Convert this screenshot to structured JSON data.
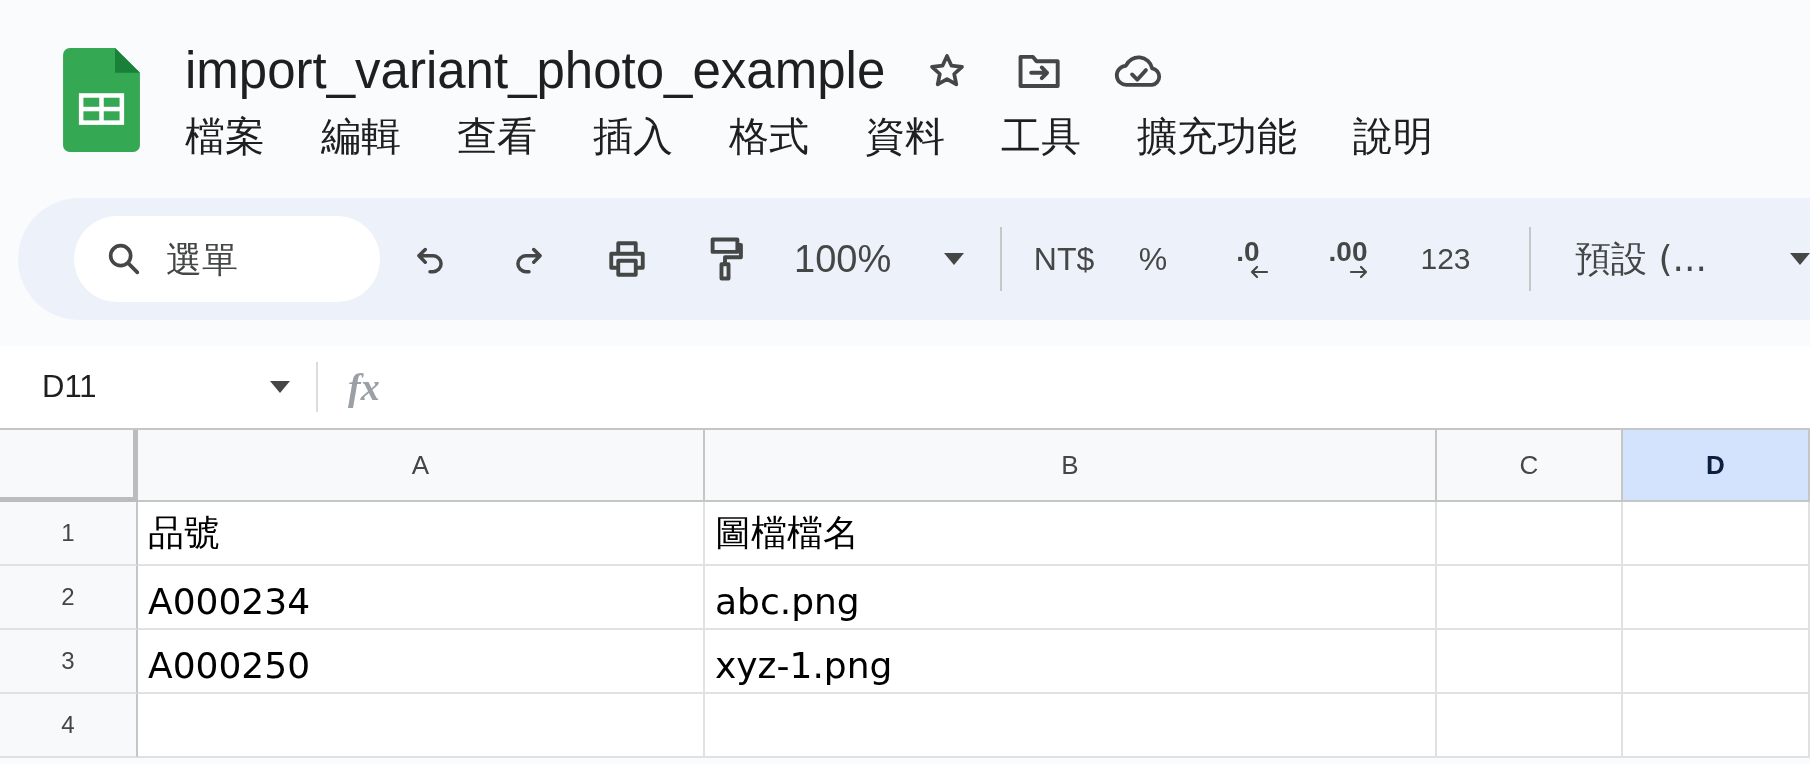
{
  "document": {
    "title": "import_variant_photo_example"
  },
  "menu": [
    "檔案",
    "編輯",
    "查看",
    "插入",
    "格式",
    "資料",
    "工具",
    "擴充功能",
    "說明"
  ],
  "toolbar": {
    "search": {
      "placeholder": "選單"
    },
    "zoom": "100%",
    "currency": "NT$",
    "percent": "%",
    "decrease_decimals": ".0",
    "increase_decimals": ".00",
    "number_format": "123",
    "font": "預設 (..."
  },
  "formula_bar": {
    "name_box": "D11",
    "formula_label": "fx"
  },
  "sheet": {
    "columns": [
      {
        "label": "A",
        "selected": false
      },
      {
        "label": "B",
        "selected": false
      },
      {
        "label": "C",
        "selected": false
      },
      {
        "label": "D",
        "selected": true
      }
    ],
    "rows": [
      {
        "label": "1",
        "cells": [
          "品號",
          "圖檔檔名"
        ]
      },
      {
        "label": "2",
        "cells": [
          "A000234",
          "abc.png"
        ]
      },
      {
        "label": "3",
        "cells": [
          "A000250",
          "xyz-1.png"
        ]
      },
      {
        "label": "4"
      }
    ]
  }
}
